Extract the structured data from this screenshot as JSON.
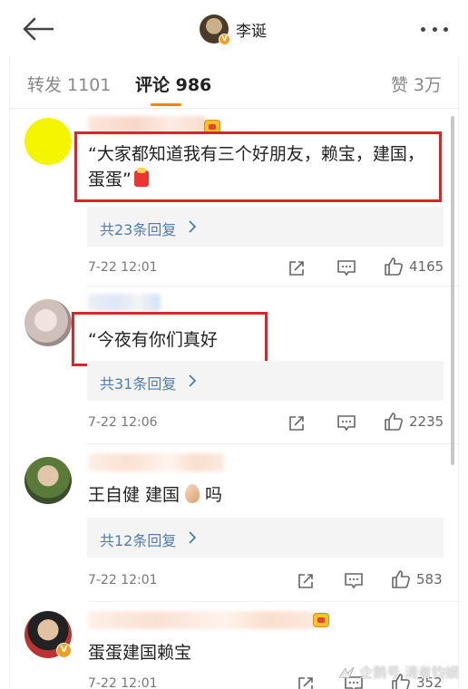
{
  "header": {
    "user_name": "李诞",
    "verified_badge": "V"
  },
  "tabs": {
    "repost": "转发 1101",
    "comment": "评论 986",
    "like": "赞 3万"
  },
  "comments": [
    {
      "text_lines": [
        "“大家都知道我有三个好朋友，赖宝，建国，",
        "蛋蛋”"
      ],
      "replies": "共23条回复",
      "time": "7-22 12:01",
      "likes": "4165"
    },
    {
      "text": "“今夜有你们真好",
      "replies": "共31条回复",
      "time": "7-22 12:06",
      "likes": "2235"
    },
    {
      "text_before": "王自健 建国",
      "text_after": "吗",
      "replies": "共12条回复",
      "time": "7-22 12:01",
      "likes": "583"
    },
    {
      "text": "蛋蛋建国赖宝",
      "verified_badge": "V",
      "time": "7-22 12:01",
      "likes": "352"
    }
  ],
  "watermark": "企鹅号 清者钧娱",
  "colors": {
    "accent": "#ff8200",
    "link": "#507daf",
    "highlight": "#d9262b"
  }
}
